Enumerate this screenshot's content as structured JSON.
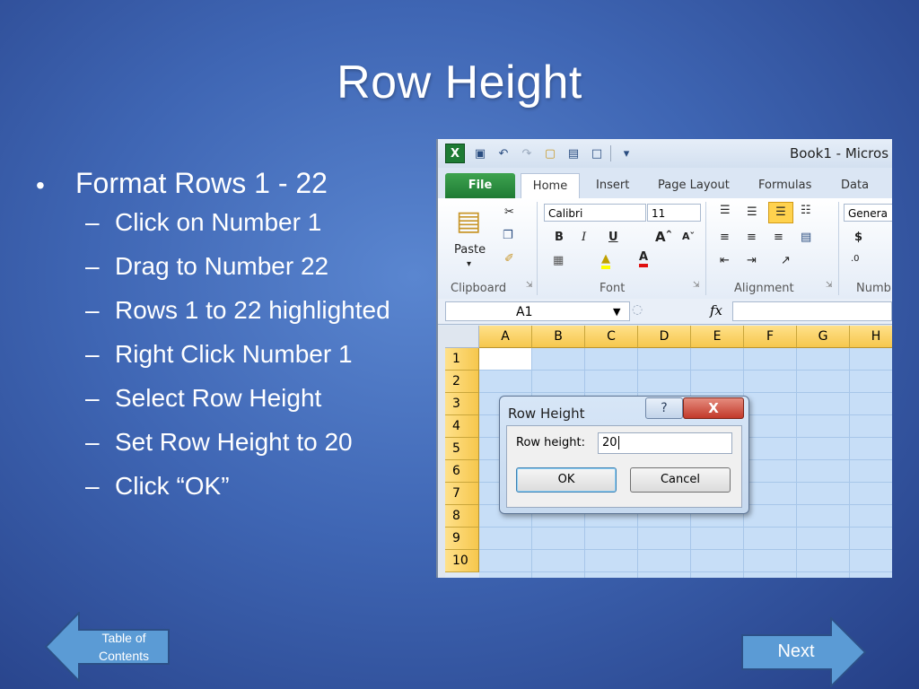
{
  "slide": {
    "title": "Row Height",
    "bullet": "Format Rows 1 - 22",
    "steps": [
      "Click on Number 1",
      "Drag to Number 22",
      "Rows 1 to 22 highlighted",
      "Right Click Number 1",
      "Select Row Height",
      "Set Row Height to 20",
      "Click “OK”"
    ],
    "bullet_glyph": "•",
    "dash_glyph": "–"
  },
  "excel": {
    "window_title": "Book1 - Micros",
    "tabs": [
      "File",
      "Home",
      "Insert",
      "Page Layout",
      "Formulas",
      "Data"
    ],
    "ribbon": {
      "paste_label": "Paste",
      "font_name": "Calibri",
      "font_size": "11",
      "number_format": "Genera",
      "groups": [
        "Clipboard",
        "Font",
        "Alignment",
        "Numb"
      ]
    },
    "name_box": "A1",
    "fx_label": "fx",
    "columns": [
      "A",
      "B",
      "C",
      "D",
      "E",
      "F",
      "G",
      "H"
    ],
    "rows": [
      "1",
      "2",
      "3",
      "4",
      "5",
      "6",
      "7",
      "8",
      "9",
      "10"
    ],
    "dialog": {
      "title": "Row Height",
      "help": "?",
      "close": "X",
      "field_label": "Row height:",
      "field_value": "20",
      "ok_label": "OK",
      "cancel_label": "Cancel"
    }
  },
  "nav": {
    "back_label_line1": "Table of",
    "back_label_line2": "Contents",
    "next_label": "Next"
  },
  "colors": {
    "arrow_fill": "#5b9bd5",
    "arrow_stroke": "#2c4f86",
    "excel_green": "#1e7b34",
    "selection_blue": "#c7def7",
    "header_gold": "#f6c74d"
  }
}
